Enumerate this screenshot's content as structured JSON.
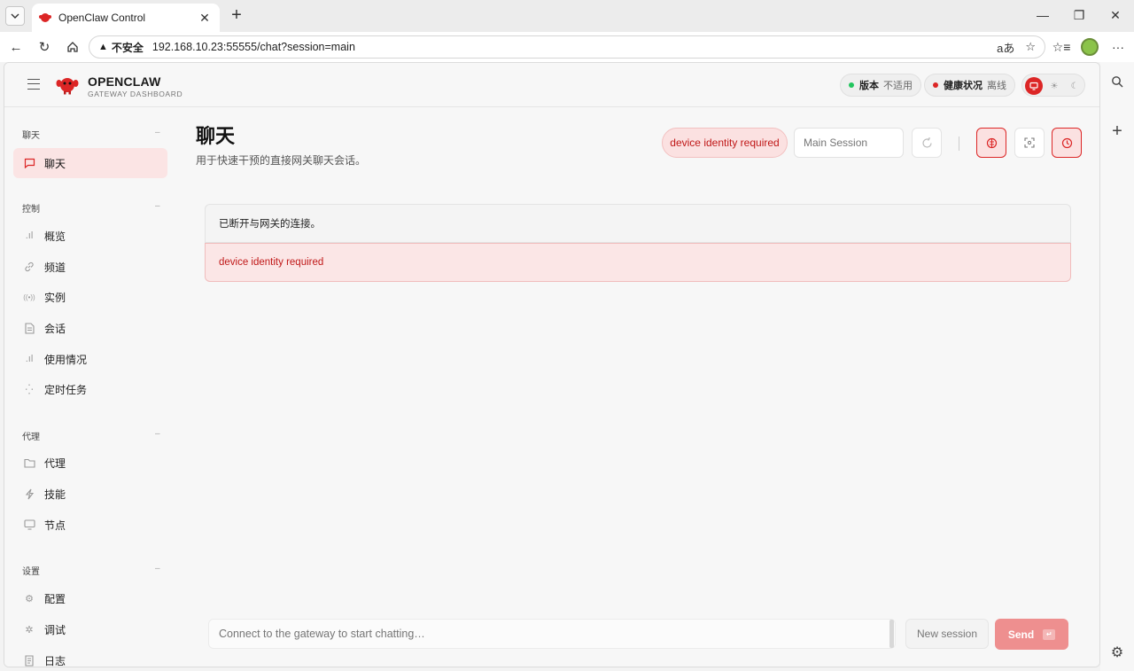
{
  "browser": {
    "tab_title": "OpenClaw Control",
    "insecure_label": "不安全",
    "url": "192.168.10.23:55555/chat?session=main"
  },
  "header": {
    "brand_name": "OPENCLAW",
    "brand_sub": "GATEWAY DASHBOARD",
    "version_label": "版本",
    "version_value": "不适用",
    "health_label": "健康状况",
    "health_value": "离线"
  },
  "sidebar": {
    "sections": [
      {
        "title": "聊天",
        "items": [
          {
            "label": "聊天",
            "icon": "chat-icon",
            "active": true
          }
        ]
      },
      {
        "title": "控制",
        "items": [
          {
            "label": "概览",
            "icon": "bar-chart-icon"
          },
          {
            "label": "频道",
            "icon": "link-icon"
          },
          {
            "label": "实例",
            "icon": "broadcast-icon"
          },
          {
            "label": "会话",
            "icon": "document-icon"
          },
          {
            "label": "使用情况",
            "icon": "bar-chart-icon"
          },
          {
            "label": "定时任务",
            "icon": "loader-icon"
          }
        ]
      },
      {
        "title": "代理",
        "items": [
          {
            "label": "代理",
            "icon": "folder-icon"
          },
          {
            "label": "技能",
            "icon": "lightning-icon"
          },
          {
            "label": "节点",
            "icon": "monitor-icon"
          }
        ]
      },
      {
        "title": "设置",
        "items": [
          {
            "label": "配置",
            "icon": "gear-icon"
          },
          {
            "label": "调试",
            "icon": "bug-icon"
          },
          {
            "label": "日志",
            "icon": "log-icon"
          }
        ]
      }
    ],
    "collapse_symbol": "–"
  },
  "main": {
    "title": "聊天",
    "subtitle": "用于快速干预的直接网关聊天会话。",
    "error_chip": "device identity required",
    "session_placeholder": "Main Session",
    "notice": "已断开与网关的连接。",
    "error_message": "device identity required",
    "composer_placeholder": "Connect to the gateway to start chatting…",
    "new_session_label": "New session",
    "send_label": "Send"
  },
  "colors": {
    "accent": "#dc2626",
    "status_ok": "#22c55e",
    "status_error": "#dc2626"
  }
}
